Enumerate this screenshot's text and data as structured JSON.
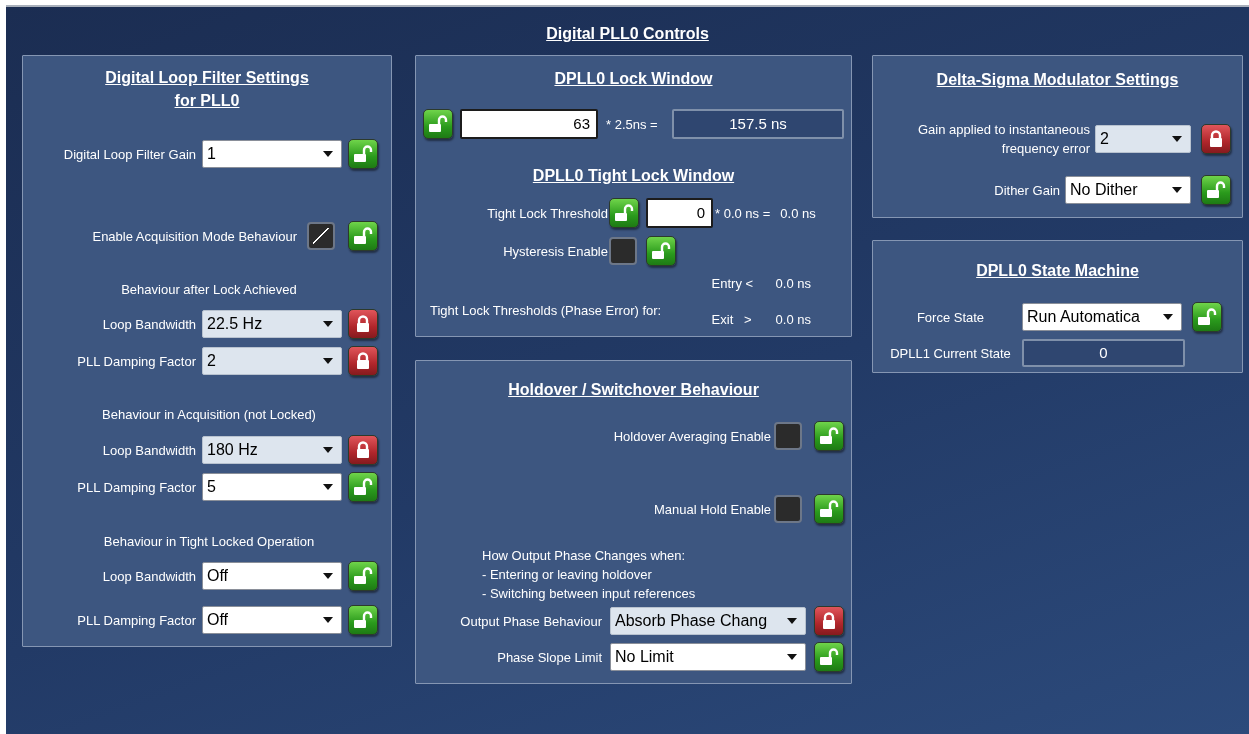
{
  "title": "Digital PLL0 Controls",
  "loop_filter": {
    "title_lines": [
      "Digital Loop Filter  Settings",
      "for PLL0"
    ],
    "rows": [
      {
        "kind": "dropdown",
        "label": "Digital Loop Filter Gain",
        "value": "1",
        "locked": false
      },
      {
        "kind": "checkbox",
        "label": "Enable Acquisition Mode Behaviour",
        "checked": true,
        "locked": false
      },
      {
        "kind": "heading",
        "text": "Behaviour after Lock Achieved"
      },
      {
        "kind": "dropdown",
        "label": "Loop Bandwidth",
        "value": "22.5 Hz",
        "locked": true
      },
      {
        "kind": "dropdown",
        "label": "PLL Damping Factor",
        "value": "2",
        "locked": true
      },
      {
        "kind": "heading",
        "text": "Behaviour in Acquisition (not Locked)"
      },
      {
        "kind": "dropdown",
        "label": "Loop Bandwidth",
        "value": "180 Hz",
        "locked": true
      },
      {
        "kind": "dropdown",
        "label": "PLL Damping Factor",
        "value": "5",
        "locked": false
      },
      {
        "kind": "heading",
        "text": "Behaviour in Tight Locked Operation"
      },
      {
        "kind": "dropdown",
        "label": "Loop Bandwidth",
        "value": "Off",
        "locked": false
      },
      {
        "kind": "dropdown",
        "label": "PLL Damping Factor",
        "value": "Off",
        "locked": false
      }
    ]
  },
  "lock_window": {
    "title": "DPLL0 Lock Window",
    "locked": false,
    "value": "63",
    "multiplier": "* 2.5ns =",
    "result": "157.5 ns"
  },
  "tight_lock_window": {
    "title": "DPLL0 Tight Lock Window",
    "threshold": {
      "label": "Tight Lock Threshold",
      "locked": false,
      "value": "0",
      "multiplier": "* 0.0 ns =",
      "result": "0.0 ns"
    },
    "hysteresis": {
      "label": "Hysteresis Enable",
      "checked": false,
      "locked": false
    },
    "thresholds": {
      "label": "Tight Lock Thresholds (Phase Error) for:",
      "entry_label": "Entry <",
      "entry_value": "0.0 ns",
      "exit_label": "Exit   >",
      "exit_value": "0.0 ns"
    }
  },
  "holdover": {
    "title": "Holdover / Switchover Behaviour",
    "rows": [
      {
        "kind": "checkbox",
        "label": "Holdover Averaging Enable",
        "checked": false,
        "locked": false
      },
      {
        "kind": "checkbox",
        "label": "Manual Hold Enable",
        "checked": false,
        "locked": false
      },
      {
        "kind": "note",
        "text": "How Output Phase Changes when:"
      },
      {
        "kind": "note",
        "text": "- Entering or leaving holdover"
      },
      {
        "kind": "note",
        "text": "- Switching between input references"
      },
      {
        "kind": "dropdown",
        "label": "Output Phase Behaviour",
        "value": "Absorb Phase Chang",
        "locked": true
      },
      {
        "kind": "dropdown",
        "label": "Phase Slope Limit",
        "value": "No Limit",
        "locked": false
      }
    ]
  },
  "delta_sigma": {
    "title": "Delta-Sigma Modulator Settings",
    "rows": [
      {
        "kind": "dropdown",
        "label": "Gain applied to instantaneous frequency error",
        "value": "2",
        "locked": true
      },
      {
        "kind": "dropdown",
        "label": "Dither Gain",
        "value": "No Dither",
        "locked": false
      }
    ]
  },
  "state_machine": {
    "title": "DPLL0 State Machine",
    "force_state": {
      "label": "Force State",
      "value": "Run Automatica",
      "locked": false
    },
    "current_state": {
      "label": "DPLL1 Current State",
      "value": "0"
    }
  }
}
